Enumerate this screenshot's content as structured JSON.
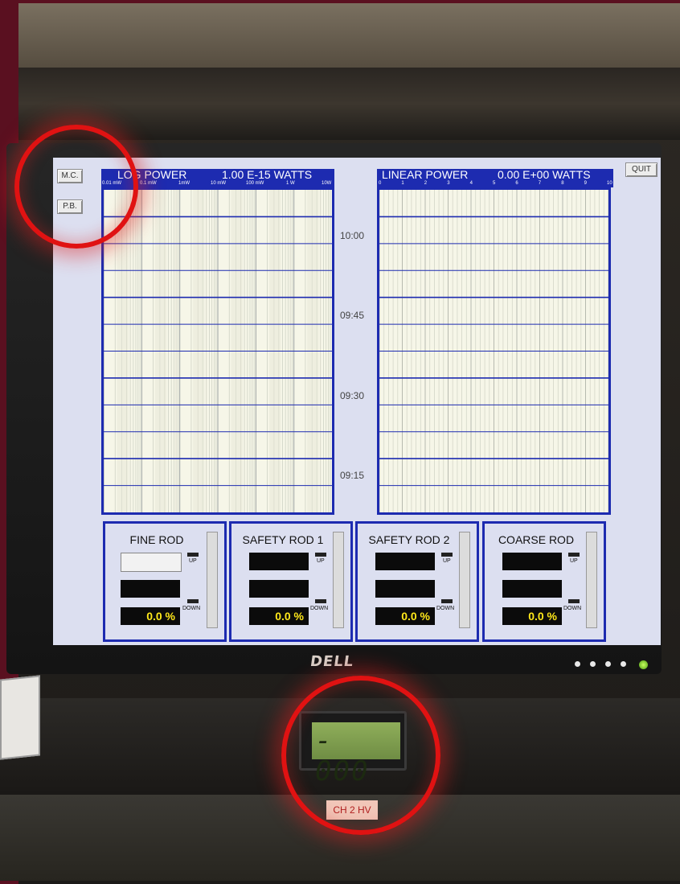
{
  "buttons": {
    "mc": "M.C.",
    "pb": "P.B.",
    "quit": "QUIT"
  },
  "log_power": {
    "label": "LOG POWER",
    "value": "1.00 E-15 WATTS",
    "scale": [
      "0.01 mW",
      "0.1 mW",
      "1mW",
      "10 mW",
      "100 mW",
      "1 W",
      "10W"
    ]
  },
  "linear_power": {
    "label": "LINEAR POWER",
    "value": "0.00 E+00 WATTS",
    "scale": [
      "0",
      "1",
      "2",
      "3",
      "4",
      "5",
      "6",
      "7",
      "8",
      "9",
      "10"
    ]
  },
  "time_labels": [
    "10:00",
    "09:45",
    "09:30",
    "09:15"
  ],
  "rods": [
    {
      "name": "FINE ROD",
      "percent": "0.0 %",
      "up": "UP",
      "down": "DOWN"
    },
    {
      "name": "SAFETY ROD 1",
      "percent": "0.0 %",
      "up": "UP",
      "down": "DOWN"
    },
    {
      "name": "SAFETY ROD 2",
      "percent": "0.0 %",
      "up": "UP",
      "down": "DOWN"
    },
    {
      "name": "COARSE ROD",
      "percent": "0.0 %",
      "up": "UP",
      "down": "DOWN"
    }
  ],
  "hardware": {
    "brand": "DELL",
    "meter_reading": "- 000",
    "channel_label": "CH 2 HV"
  },
  "colors": {
    "accent_blue": "#1d2bb0",
    "screen_bg": "#dcdff0",
    "percent_yellow": "#ffe81a",
    "highlight_red": "#e01212"
  }
}
